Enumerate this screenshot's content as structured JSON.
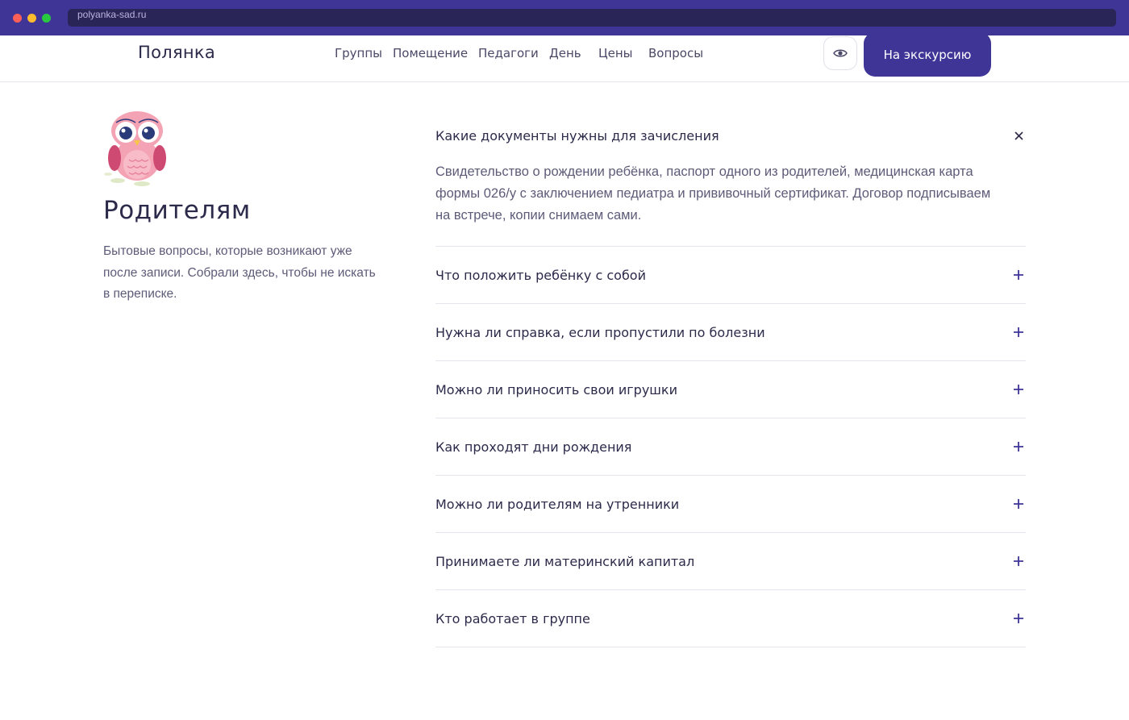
{
  "browser": {
    "url": "polyanka-sad.ru"
  },
  "header": {
    "logo": "Полянка",
    "nav": [
      "Группы",
      "Помещение",
      "Педагоги",
      "День",
      "Цены",
      "Вопросы"
    ],
    "cta_label": "На экскурсию"
  },
  "intro": {
    "title": "Родителям",
    "lead": "Бытовые вопросы, которые возникают уже после записи. Собрали здесь, чтобы не искать в переписке."
  },
  "faq": {
    "items": [
      {
        "question": "Какие документы нужны для зачисления",
        "answer": "Свидетельство о рождении ребёнка, паспорт одного из родителей, медицинская карта формы 026/у с заключением педиатра и прививочный сертификат. Договор подписываем на встрече, копии снимаем сами.",
        "open": true
      },
      {
        "question": "Что положить ребёнку с собой",
        "open": false
      },
      {
        "question": "Нужна ли справка, если пропустили по болезни",
        "open": false
      },
      {
        "question": "Можно ли приносить свои игрушки",
        "open": false
      },
      {
        "question": "Как проходят дни рождения",
        "open": false
      },
      {
        "question": "Можно ли родителям на утренники",
        "open": false
      },
      {
        "question": "Принимаете ли материнский капитал",
        "open": false
      },
      {
        "question": "Кто работает в группе",
        "open": false
      }
    ]
  },
  "icons": {
    "eye": "eye-icon",
    "close": "close-icon",
    "plus": "plus-icon",
    "mascot": "owl-icon"
  },
  "colors": {
    "brand": "#3f3597",
    "text": "#2c2a4a",
    "muted": "#5d5b78",
    "divider": "#e6e4ee"
  }
}
